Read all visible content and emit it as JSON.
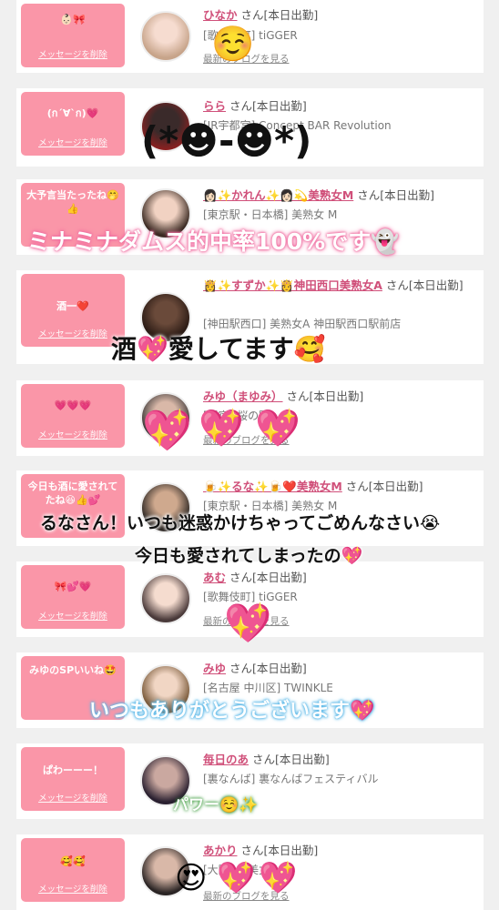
{
  "delete_label": "メッセージを削除",
  "blog_label": "最新のブログを見る",
  "cards": [
    {
      "msg": "👶🏻🎀",
      "name": "ひなか",
      "suffix": "さん[本日出勤]",
      "shop": "[歌舞伎町] tiGGER"
    },
    {
      "msg": "(ก´∀`ก)💗",
      "name": "らら",
      "suffix": "さん[本日出勤]",
      "shop": "[JR宇都宮] Concept BAR Revolution"
    },
    {
      "msg": "大予言当たったね🤭👍",
      "name": "👩🏻✨かれん✨👩🏻💫美熟女M",
      "suffix": "さん[本日出勤]",
      "shop": "[東京駅・日本橋] 美熟女 M"
    },
    {
      "msg": "酒一❤️",
      "name": "👸✨すずか✨👸神田西口美熟女A",
      "suffix": "さん[本日出勤]",
      "shop": "[神田駅西口] 美熟女A 神田駅西口駅前店"
    },
    {
      "msg": "💗💗💗",
      "name": "みゆ（まゆみ）",
      "suffix": "さん[本日出勤]",
      "shop": "[新宿] 桜の園"
    },
    {
      "msg": "今日も酒に愛されてたね😆👍💕",
      "name": "🍺✨るな✨🍺❤️美熟女M",
      "suffix": "さん[本日出勤]",
      "shop": "[東京駅・日本橋] 美熟女 M"
    },
    {
      "msg": "🎀💕💗",
      "name": "あむ",
      "suffix": "さん[本日出勤]",
      "shop": "[歌舞伎町] tiGGER"
    },
    {
      "msg": "みゆのSPいいね🤩",
      "name": "みゆ",
      "suffix": "さん[本日出勤]",
      "shop": "[名古屋 中川区] TWINKLE"
    },
    {
      "msg": "ぱわーーー！",
      "name": "毎日のあ",
      "suffix": "さん[本日出勤]",
      "shop": "[裏なんば] 裏なんばフェスティバル"
    },
    {
      "msg": "🥰🥰",
      "name": "あかり",
      "suffix": "さん[本日出勤]",
      "shop": "[大阪・] 美女BAR"
    }
  ],
  "overlays": {
    "o1": "(*☻-☻*)",
    "o2": "ミナミナダムス的中率100%です👻",
    "o3": "酒💖愛してます🥰",
    "o4": "るなさん！いつも迷惑かけちゃってごめんなさい😭",
    "o5": "今日も愛されてしまったの💖",
    "o6": "いつもありがとうございます💖",
    "o7": "パワー☺️✨"
  },
  "stickers": {
    "s1": "☺️",
    "s2": "💖",
    "s3": "💖",
    "s4": "💖",
    "s5": "💖",
    "s6": "😍",
    "s7": "💖",
    "s8": "💖"
  }
}
